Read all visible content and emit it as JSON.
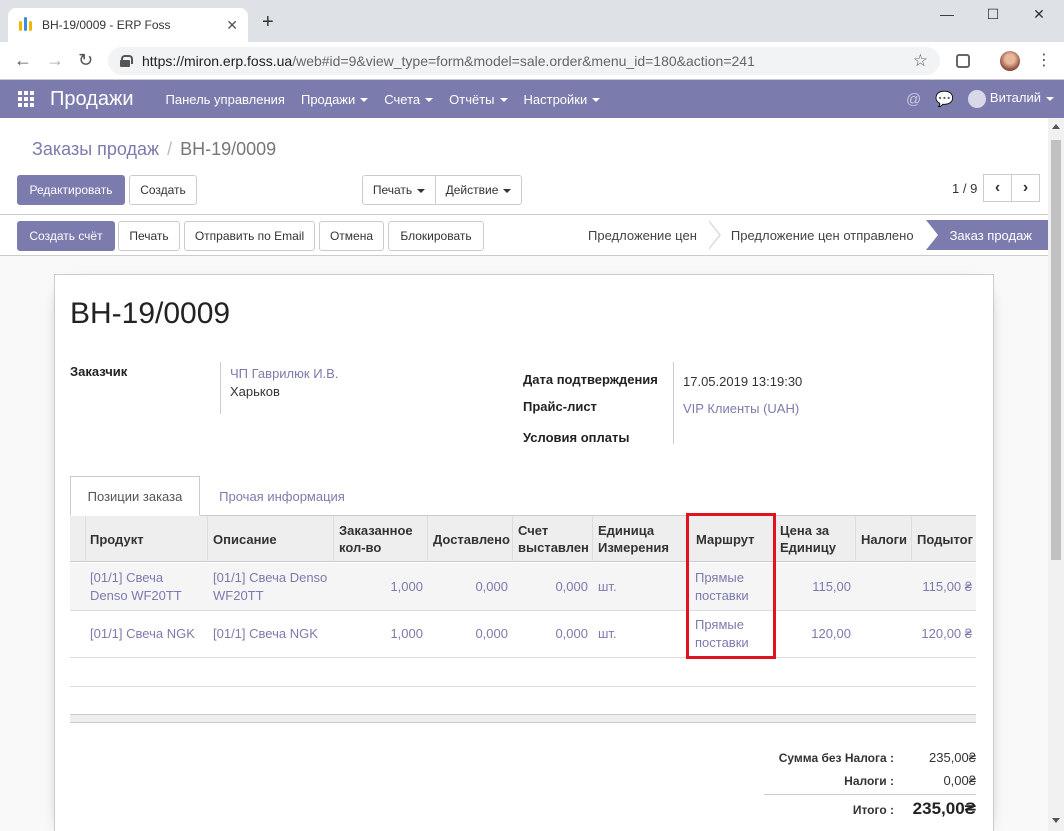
{
  "browser": {
    "tab_title": "ВН-19/0009 - ERP Foss",
    "url_host": "https://miron.erp.foss.ua",
    "url_path": "/web#id=9&view_type=form&model=sale.order&menu_id=180&action=241"
  },
  "navbar": {
    "app_name": "Продажи",
    "menu": [
      "Панель управления",
      "Продажи",
      "Счета",
      "Отчёты",
      "Настройки"
    ],
    "user": "Виталий"
  },
  "control_panel": {
    "breadcrumb_parent": "Заказы продаж",
    "breadcrumb_current": "ВН-19/0009",
    "edit_label": "Редактировать",
    "create_label": "Создать",
    "print_label": "Печать",
    "action_label": "Действие",
    "pager": "1 / 9"
  },
  "statusbar": {
    "buttons": [
      "Создать счёт",
      "Печать",
      "Отправить по Email",
      "Отмена",
      "Блокировать"
    ],
    "steps": [
      "Предложение цен",
      "Предложение цен отправлено"
    ],
    "active_step": "Заказ продаж"
  },
  "form": {
    "title": "ВН-19/0009",
    "customer_label": "Заказчик",
    "customer_name": "ЧП Гаврилюк И.В.",
    "customer_city": "Харьков",
    "confirm_date_label": "Дата подтверждения",
    "confirm_date": "17.05.2019 13:19:30",
    "pricelist_label": "Прайс-лист",
    "pricelist": "VIP Клиенты (UAH)",
    "payment_terms_label": "Условия оплаты",
    "tabs": [
      "Позиции заказа",
      "Прочая информация"
    ]
  },
  "table": {
    "headers": {
      "product": "Продукт",
      "description": "Описание",
      "ordered_1": "Заказанное",
      "ordered_2": "кол-во",
      "delivered": "Доставлено",
      "invoiced_1": "Счет",
      "invoiced_2": "выставлен",
      "uom_1": "Единица",
      "uom_2": "Измерения",
      "route": "Маршрут",
      "price_1": "Цена за",
      "price_2": "Единицу",
      "taxes": "Налоги",
      "subtotal": "Подытог"
    },
    "rows": [
      {
        "product_1": "[01/1] Свеча",
        "product_2": "Denso WF20TT",
        "desc_1": "[01/1] Свеча Denso",
        "desc_2": "WF20TT",
        "ordered": "1,000",
        "delivered": "0,000",
        "invoiced": "0,000",
        "uom": "шт.",
        "route_1": "Прямые",
        "route_2": "поставки",
        "price": "115,00",
        "subtotal": "115,00 ₴"
      },
      {
        "product_1": "[01/1] Свеча NGK",
        "desc_1": "[01/1] Свеча NGK",
        "ordered": "1,000",
        "delivered": "0,000",
        "invoiced": "0,000",
        "uom": "шт.",
        "route_1": "Прямые",
        "route_2": "поставки",
        "price": "120,00",
        "subtotal": "120,00 ₴"
      }
    ]
  },
  "totals": {
    "untaxed_label": "Сумма без Налога :",
    "untaxed": "235,00₴",
    "taxes_label": "Налоги :",
    "taxes": "0,00₴",
    "total_label": "Итого :",
    "total": "235,00₴"
  },
  "colors": {
    "brand": "#7c7bad",
    "highlight": "#e0141e"
  }
}
